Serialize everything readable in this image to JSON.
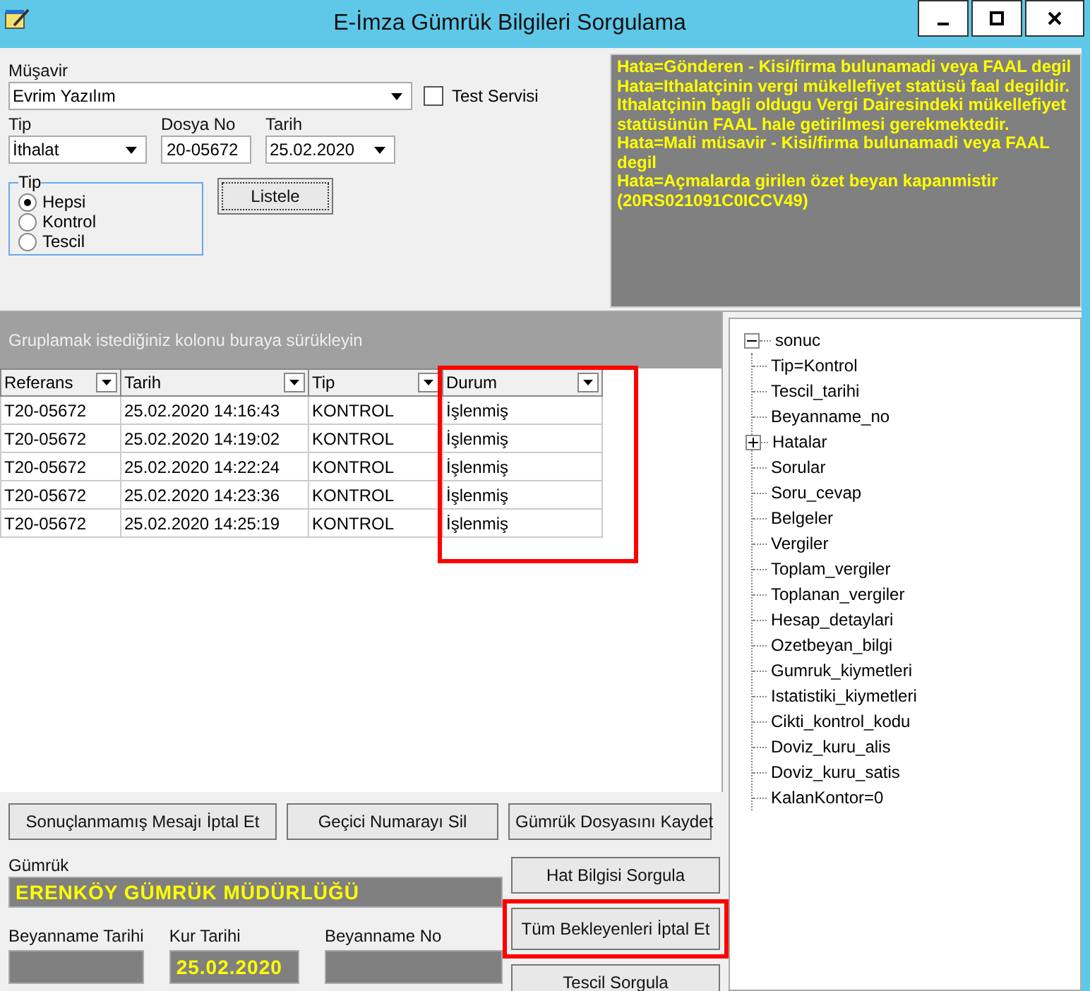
{
  "window": {
    "title": "E-İmza Gümrük Bilgileri Sorgulama"
  },
  "form": {
    "musavir": {
      "label": "Müşavir",
      "value": "Evrim Yazılım"
    },
    "test_servisi": {
      "label": "Test Servisi",
      "checked": false
    },
    "tip": {
      "label": "Tip",
      "value": "İthalat"
    },
    "dosya_no": {
      "label": "Dosya No",
      "value": "20-05672"
    },
    "tarih": {
      "label": "Tarih",
      "value": "25.02.2020"
    },
    "tip_group": {
      "label": "Tip",
      "options": [
        {
          "label": "Hepsi",
          "selected": true
        },
        {
          "label": "Kontrol",
          "selected": false
        },
        {
          "label": "Tescil",
          "selected": false
        }
      ]
    },
    "list_button": "Listele"
  },
  "errors": [
    "Hata=Gönderen - Kisi/firma bulunamadi veya FAAL degil",
    "Hata=Ithalatçinin vergi mükellefiyet statüsü faal degildir. Ithalatçinin bagli oldugu Vergi Dairesindeki mükellefiyet statüsünün FAAL hale getirilmesi gerekmektedir.",
    "Hata=Mali müsavir - Kisi/firma bulunamadi veya FAAL degil",
    "Hata=Açmalarda girilen özet beyan kapanmistir (20RS021091C0ICCV49)"
  ],
  "grid": {
    "group_hint": "Gruplamak istediğiniz kolonu buraya sürükleyin",
    "columns": [
      {
        "label": "Referans",
        "highlighted": false
      },
      {
        "label": "Tarih",
        "highlighted": false
      },
      {
        "label": "Tip",
        "highlighted": false
      },
      {
        "label": "Durum",
        "highlighted": true
      }
    ],
    "rows": [
      [
        "T20-05672",
        "25.02.2020 14:16:43",
        "KONTROL",
        "İşlenmiş"
      ],
      [
        "T20-05672",
        "25.02.2020 14:19:02",
        "KONTROL",
        "İşlenmiş"
      ],
      [
        "T20-05672",
        "25.02.2020 14:22:24",
        "KONTROL",
        "İşlenmiş"
      ],
      [
        "T20-05672",
        "25.02.2020 14:23:36",
        "KONTROL",
        "İşlenmiş"
      ],
      [
        "T20-05672",
        "25.02.2020 14:25:19",
        "KONTROL",
        "İşlenmiş"
      ]
    ]
  },
  "tree": {
    "label": "sonuc",
    "expanded": true,
    "children": [
      {
        "label": "Tip=Kontrol"
      },
      {
        "label": "Tescil_tarihi"
      },
      {
        "label": "Beyanname_no"
      },
      {
        "label": "Hatalar",
        "expanded": false
      },
      {
        "label": "Sorular"
      },
      {
        "label": "Soru_cevap"
      },
      {
        "label": "Belgeler"
      },
      {
        "label": "Vergiler"
      },
      {
        "label": "Toplam_vergiler"
      },
      {
        "label": "Toplanan_vergiler"
      },
      {
        "label": "Hesap_detaylari"
      },
      {
        "label": "Ozetbeyan_bilgi"
      },
      {
        "label": "Gumruk_kiymetleri"
      },
      {
        "label": "Istatistiki_kiymetleri"
      },
      {
        "label": "Cikti_kontrol_kodu"
      },
      {
        "label": "Doviz_kuru_alis"
      },
      {
        "label": "Doviz_kuru_satis"
      },
      {
        "label": "KalanKontor=0"
      }
    ]
  },
  "row_buttons": [
    {
      "label": "Sonuçlanmamış Mesajı İptal Et"
    },
    {
      "label": "Geçici Numarayı Sil"
    },
    {
      "label": "Gümrük Dosyasını Kaydet"
    }
  ],
  "side_buttons": [
    {
      "label": "Hat Bilgisi Sorgula",
      "highlighted": false
    },
    {
      "label": "Tüm Bekleyenleri İptal Et",
      "highlighted": true
    },
    {
      "label": "Tescil Sorgula",
      "highlighted": false
    }
  ],
  "gumruk": {
    "label": "Gümrük",
    "value": "ERENKÖY GÜMRÜK MÜDÜRLÜĞÜ"
  },
  "bottom_fields": [
    {
      "label": "Beyanname Tarihi"
    },
    {
      "label": "Kur Tarihi",
      "value": "25.02.2020"
    },
    {
      "label": "Beyanname No"
    }
  ]
}
